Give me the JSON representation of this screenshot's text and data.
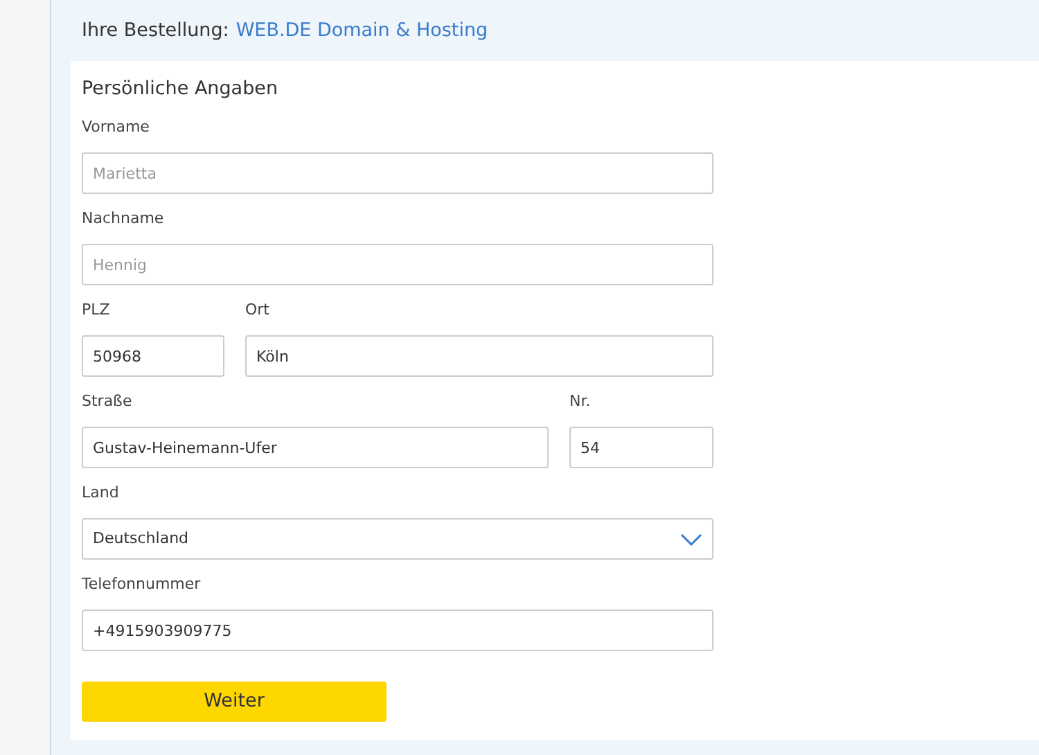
{
  "order": {
    "label": "Ihre Bestellung:",
    "product": "WEB.DE Domain & Hosting"
  },
  "form": {
    "title": "Persönliche Angaben",
    "rows": [
      [
        {
          "kind": "text",
          "label": "Vorname",
          "placeholder": "Marietta"
        }
      ],
      [
        {
          "kind": "text",
          "label": "Nachname",
          "placeholder": "Hennig"
        }
      ],
      [
        {
          "kind": "text",
          "label": "PLZ",
          "value": "50968"
        },
        {
          "kind": "text",
          "label": "Ort",
          "value": "Köln"
        }
      ],
      [
        {
          "kind": "text",
          "label": "Straße",
          "value": "Gustav-Heinemann-Ufer"
        },
        {
          "kind": "text",
          "label": "Nr.",
          "value": "54"
        }
      ],
      [
        {
          "kind": "select",
          "label": "Land",
          "value": "Deutschland"
        }
      ],
      [
        {
          "kind": "text",
          "label": "Telefonnummer",
          "value": "+4915903909775"
        }
      ]
    ],
    "button": "Weiter"
  }
}
